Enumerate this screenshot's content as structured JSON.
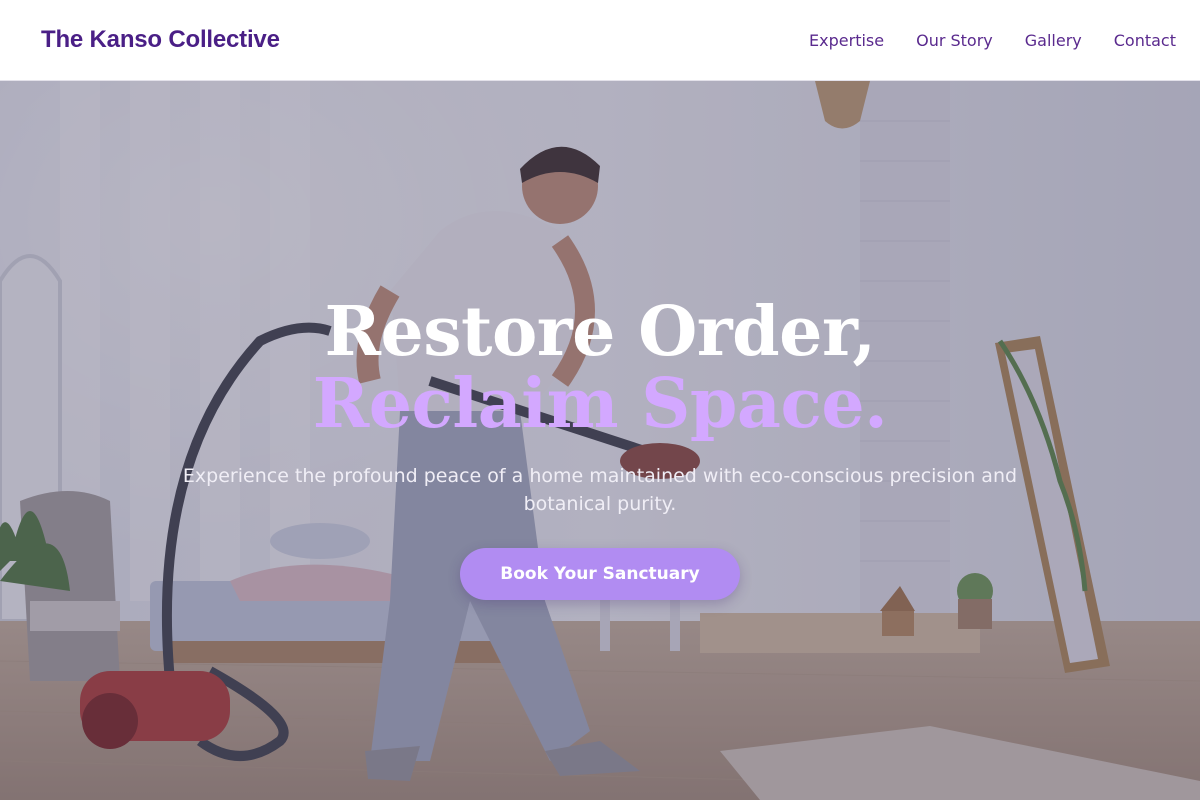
{
  "brand": {
    "name": "The Kanso Collective",
    "color": "#4a1f86"
  },
  "nav": {
    "items": [
      {
        "label": "Expertise"
      },
      {
        "label": "Our Story"
      },
      {
        "label": "Gallery"
      },
      {
        "label": "Contact"
      }
    ]
  },
  "hero": {
    "headline_line1": "Restore Order,",
    "headline_line2": "Reclaim Space.",
    "subtitle": "Experience the profound peace of a home maintained with eco-conscious precision and botanical purity.",
    "cta_label": "Book Your Sanctuary",
    "accent_color": "#d3a8ff",
    "cta_color": "#b18cf2",
    "background_image": "man vacuuming a bright bedroom"
  }
}
